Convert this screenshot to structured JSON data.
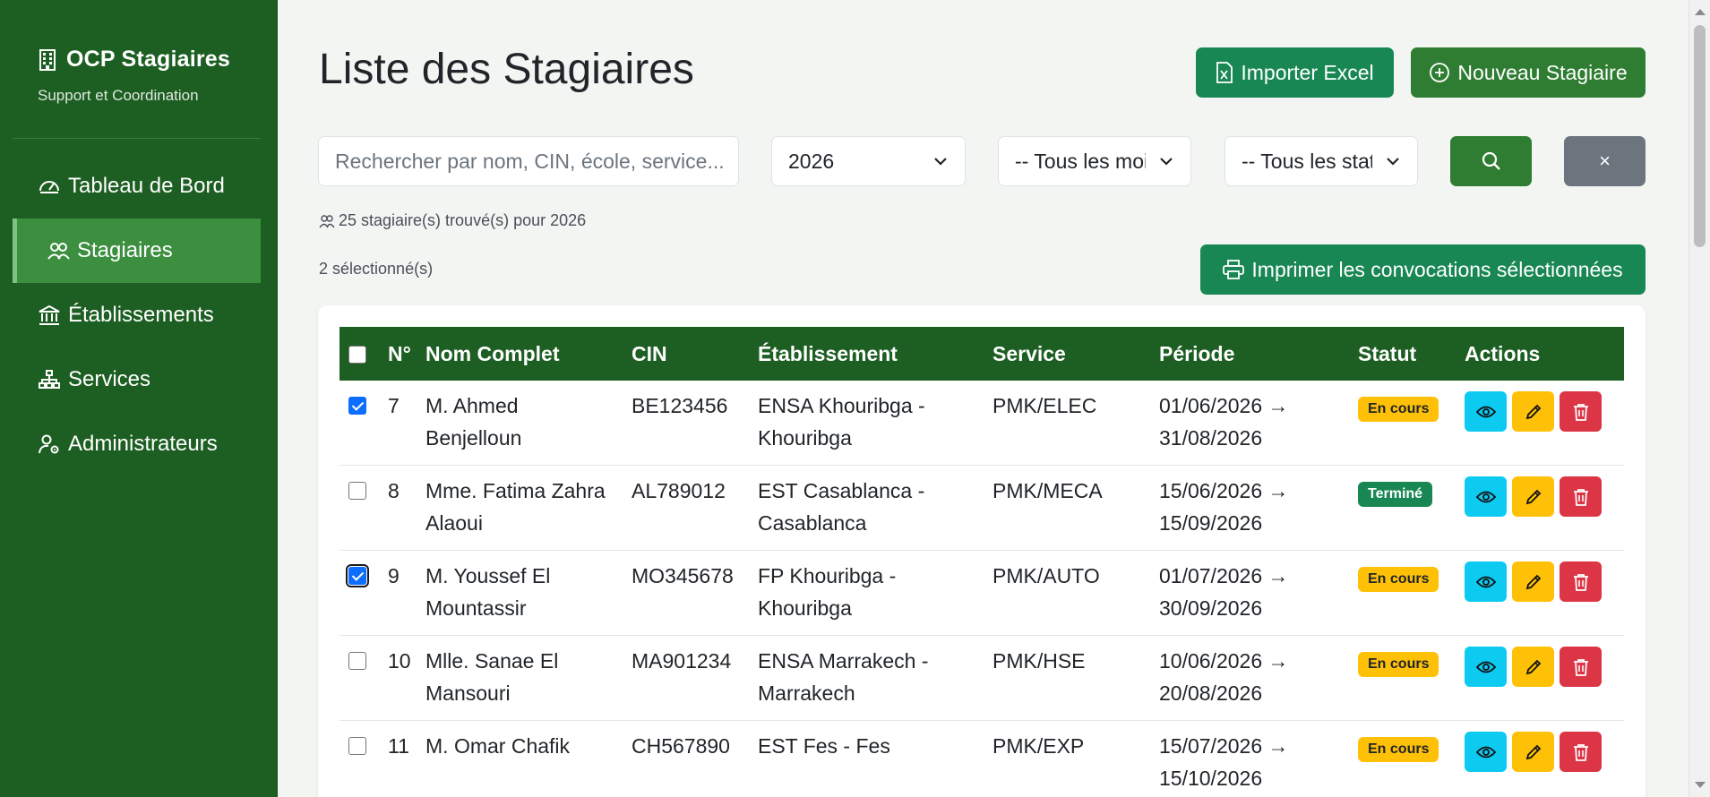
{
  "sidebar": {
    "brand_title": "OCP Stagiaires",
    "brand_subtitle": "Support et Coordination",
    "items": [
      {
        "label": "Tableau de Bord",
        "icon": "speedometer-icon",
        "active": false
      },
      {
        "label": "Stagiaires",
        "icon": "people-icon",
        "active": true
      },
      {
        "label": "Établissements",
        "icon": "bank-icon",
        "active": false
      },
      {
        "label": "Services",
        "icon": "diagram-icon",
        "active": false
      },
      {
        "label": "Administrateurs",
        "icon": "user-gear-icon",
        "active": false
      }
    ]
  },
  "header": {
    "title": "Liste des Stagiaires",
    "import_label": "Importer Excel",
    "new_label": "Nouveau Stagiaire"
  },
  "filters": {
    "search_placeholder": "Rechercher par nom, CIN, école, service...",
    "year": "2026",
    "month": "-- Tous les mois --",
    "status": "-- Tous les statuts --",
    "clear_label": "×"
  },
  "summary": {
    "count_text": "25 stagiaire(s) trouvé(s) pour 2026",
    "selected_text": "2 sélectionné(s)",
    "print_label": "Imprimer les convocations sélectionnées"
  },
  "table": {
    "headers": [
      "N°",
      "Nom Complet",
      "CIN",
      "Établissement",
      "Service",
      "Période",
      "Statut",
      "Actions"
    ],
    "rows": [
      {
        "n": "7",
        "name": "M. Ahmed Benjelloun",
        "cin": "BE123456",
        "etab": "ENSA Khouribga - Khouribga",
        "service": "PMK/ELEC",
        "periode": "01/06/2026 → 31/08/2026",
        "statut": "En cours",
        "checked": true
      },
      {
        "n": "8",
        "name": "Mme. Fatima Zahra Alaoui",
        "cin": "AL789012",
        "etab": "EST Casablanca - Casablanca",
        "service": "PMK/MECA",
        "periode": "15/06/2026 → 15/09/2026",
        "statut": "Terminé",
        "checked": false
      },
      {
        "n": "9",
        "name": "M. Youssef El Mountassir",
        "cin": "MO345678",
        "etab": "FP Khouribga - Khouribga",
        "service": "PMK/AUTO",
        "periode": "01/07/2026 → 30/09/2026",
        "statut": "En cours",
        "checked": true
      },
      {
        "n": "10",
        "name": "Mlle. Sanae El Mansouri",
        "cin": "MA901234",
        "etab": "ENSA Marrakech - Marrakech",
        "service": "PMK/HSE",
        "periode": "10/06/2026 → 20/08/2026",
        "statut": "En cours",
        "checked": false
      },
      {
        "n": "11",
        "name": "M. Omar Chafik",
        "cin": "CH567890",
        "etab": "EST Fes - Fes",
        "service": "PMK/EXP",
        "periode": "15/07/2026 → 15/10/2026",
        "statut": "En cours",
        "checked": false
      }
    ]
  },
  "colors": {
    "sidebar": "#1d5e22",
    "sidebar_active": "#3c8f3f",
    "primary_green": "#2e7d32",
    "success": "#198754",
    "warning": "#ffc107",
    "info": "#0dcaf0",
    "danger": "#dc3545"
  }
}
